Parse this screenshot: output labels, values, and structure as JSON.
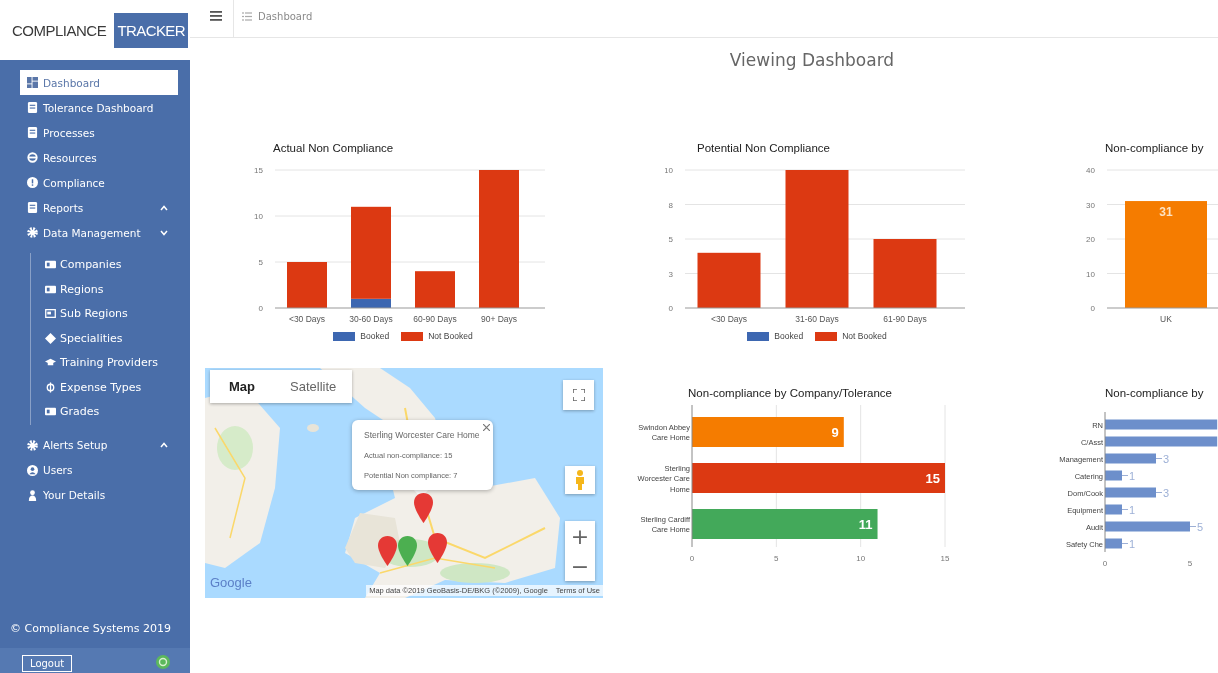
{
  "header": {
    "logo_text": "COMPLIANCE",
    "logo_highlight": "TRACKER",
    "breadcrumb": "Dashboard"
  },
  "sidebar": {
    "items": [
      {
        "label": "Dashboard",
        "selected": true
      },
      {
        "label": "Tolerance Dashboard",
        "selected": false
      },
      {
        "label": "Processes",
        "selected": false
      },
      {
        "label": "Resources",
        "selected": false
      },
      {
        "label": "Compliance",
        "selected": false
      },
      {
        "label": "Reports",
        "selected": false,
        "expanded": false
      },
      {
        "label": "Data Management",
        "selected": false,
        "expanded": true,
        "children": [
          {
            "label": "Companies",
            "selected": false
          },
          {
            "label": "Regions",
            "selected": false
          },
          {
            "label": "Sub Regions",
            "selected": false
          },
          {
            "label": "Specialities",
            "selected": false
          },
          {
            "label": "Training Providers",
            "selected": false
          },
          {
            "label": "Expense Types",
            "selected": false
          },
          {
            "label": "Grades",
            "selected": false
          }
        ]
      },
      {
        "label": "Alerts Setup",
        "selected": false,
        "expanded": false
      },
      {
        "label": "Users",
        "selected": false
      },
      {
        "label": "Your Details",
        "selected": false
      }
    ],
    "copyright": "© Compliance Systems 2019",
    "logout_button": "Logout"
  },
  "page_title": "Viewing Dashboard",
  "charts": [
    {
      "chart_data": {
        "type": "bar",
        "title": "Actual Non Compliance",
        "categories": [
          "<30 Days",
          "30-60 Days",
          "60-90 Days",
          "90+ Days"
        ],
        "series": [
          {
            "name": "Booked",
            "color": "#3d67b1",
            "values": [
              0,
              1,
              0,
              0
            ]
          },
          {
            "name": "Not Booked",
            "color": "#dc3912",
            "values": [
              5,
              10,
              4,
              15
            ]
          }
        ],
        "stacked": true,
        "ylim": [
          0,
          15
        ],
        "yticks": [
          0,
          5,
          10,
          15
        ],
        "grid": true
      }
    },
    {
      "chart_data": {
        "type": "bar",
        "title": "Potential Non Compliance",
        "categories": [
          "<30 Days",
          "31-60 Days",
          "61-90 Days"
        ],
        "series": [
          {
            "name": "Booked",
            "color": "#3d67b1",
            "values": [
              0,
              0,
              0
            ]
          },
          {
            "name": "Not Booked",
            "color": "#dc3912",
            "values": [
              4,
              10,
              5
            ]
          }
        ],
        "stacked": true,
        "ylim": [
          0,
          10
        ],
        "yticks": [
          0,
          {
            "value": 2.5,
            "label": "3"
          },
          5,
          {
            "value": 7.5,
            "label": "8"
          },
          10
        ],
        "grid": true
      }
    },
    {
      "chart_data": {
        "type": "bar",
        "title": "Non-compliance by",
        "categories": [
          "UK"
        ],
        "series": [
          {
            "color": "#f57c00",
            "values": [
              31
            ]
          }
        ],
        "ylim": [
          0,
          40
        ],
        "yticks": [
          0,
          10,
          20,
          30,
          40
        ],
        "data_labels": true,
        "grid": true
      }
    }
  ],
  "map": {
    "type_tabs": [
      {
        "label": "Map",
        "selected": true
      },
      {
        "label": "Satellite",
        "selected": false
      }
    ],
    "info_window": {
      "title": "Sterling Worcester Care Home",
      "lines": [
        "Actual non-compliance: 15",
        "Potential Non compliance: 7"
      ]
    },
    "markers": [
      {
        "color": "#e53935"
      },
      {
        "color": "#e53935"
      },
      {
        "color": "#4caf50"
      },
      {
        "color": "#e53935"
      }
    ],
    "zoom_in": "+",
    "zoom_out": "−",
    "logo": "Google",
    "attribution": "Map data ©2019 GeoBasis-DE/BKG (©2009), Google",
    "terms_link": "Terms of Use"
  },
  "lower_charts": [
    {
      "chart_data": {
        "type": "bar",
        "orientation": "horizontal",
        "title": "Non-compliance by Company/Tolerance",
        "categories": [
          "Swindon Abbey Care Home",
          "Sterling Worcester Care Home",
          "Sterling Cardiff Care Home"
        ],
        "series": [
          {
            "color": "#f57c00",
            "values": [
              9,
              null,
              null
            ]
          },
          {
            "color": "#dc3912",
            "values": [
              null,
              15,
              null
            ]
          },
          {
            "color": "#43a95a",
            "values": [
              null,
              null,
              11
            ]
          }
        ],
        "stacked": true,
        "xlim": [
          0,
          15
        ],
        "xticks": [
          0,
          5,
          10,
          15
        ],
        "data_labels": true,
        "grid": true
      }
    },
    {
      "chart_data": {
        "type": "bar",
        "orientation": "horizontal",
        "title": "Non-compliance by",
        "categories": [
          "RN",
          "C/Asst",
          "Management",
          "Catering",
          "Dom/Cook",
          "Equipment",
          "Audit",
          "Safety Che"
        ],
        "series": [
          {
            "color": "#6d8fcb",
            "values": [
              6.6,
              6.6,
              3,
              1,
              3,
              1,
              5,
              1
            ]
          }
        ],
        "xlim": [
          0,
          6.6
        ],
        "xticks": [
          0,
          5
        ],
        "value_labels": [
          null,
          null,
          "3",
          "1",
          "3",
          "1",
          "5",
          "1"
        ]
      }
    }
  ]
}
